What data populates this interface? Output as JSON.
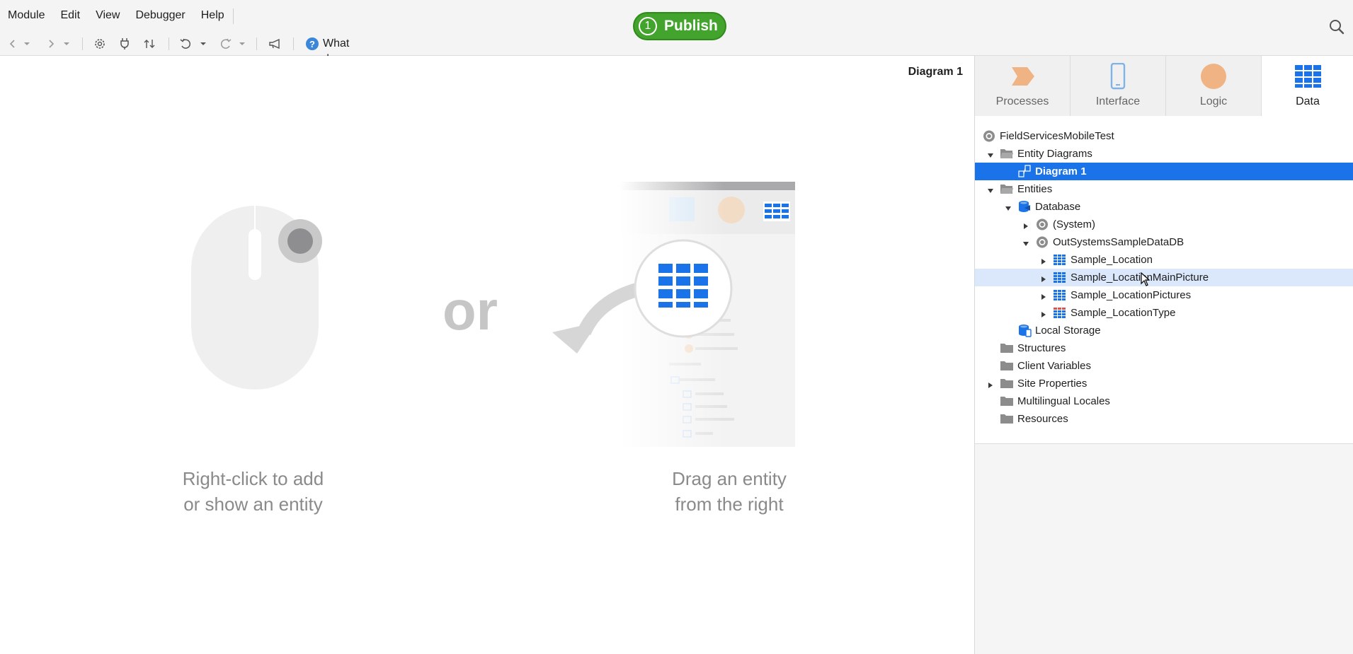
{
  "menu": [
    "Module",
    "Edit",
    "View",
    "Debugger",
    "Help"
  ],
  "publish": {
    "count": "1",
    "label": "Publish"
  },
  "toolbar": {
    "help_placeholder": "What do you want to do?"
  },
  "canvas": {
    "diagram_title": "Diagram 1",
    "hint_left": [
      "Right-click to add",
      "or show an entity"
    ],
    "or_text": "or",
    "hint_right": [
      "Drag an entity",
      "from the right"
    ]
  },
  "tabs": [
    {
      "label": "Processes",
      "icon": "process-icon"
    },
    {
      "label": "Interface",
      "icon": "phone-icon"
    },
    {
      "label": "Logic",
      "icon": "logic-icon"
    },
    {
      "label": "Data",
      "icon": "data-icon",
      "active": true
    }
  ],
  "tree": [
    {
      "label": "FieldServicesMobileTest",
      "icon": "module-icon",
      "level": 0,
      "caret": ""
    },
    {
      "label": "Entity Diagrams",
      "icon": "folder-open-icon",
      "level": 1,
      "caret": "down"
    },
    {
      "label": "Diagram 1",
      "icon": "diagram-icon",
      "level": 2,
      "caret": "",
      "selected": true
    },
    {
      "label": "Entities",
      "icon": "folder-open-icon",
      "level": 1,
      "caret": "down"
    },
    {
      "label": "Database",
      "icon": "database-icon",
      "level": 2,
      "caret": "down"
    },
    {
      "label": "(System)",
      "icon": "module-icon",
      "level": 3,
      "caret": "right"
    },
    {
      "label": "OutSystemsSampleDataDB",
      "icon": "module-icon",
      "level": 3,
      "caret": "down"
    },
    {
      "label": "Sample_Location",
      "icon": "entity-icon",
      "level": 4,
      "caret": "right"
    },
    {
      "label": "Sample_LocationMainPicture",
      "icon": "entity-icon",
      "level": 4,
      "caret": "right",
      "hover": true
    },
    {
      "label": "Sample_LocationPictures",
      "icon": "entity-icon",
      "level": 4,
      "caret": "right"
    },
    {
      "label": "Sample_LocationType",
      "icon": "static-entity-icon",
      "level": 4,
      "caret": "right"
    },
    {
      "label": "Local Storage",
      "icon": "local-storage-icon",
      "level": 2,
      "caret": ""
    },
    {
      "label": "Structures",
      "icon": "folder-icon",
      "level": 1,
      "caret": ""
    },
    {
      "label": "Client Variables",
      "icon": "folder-icon",
      "level": 1,
      "caret": ""
    },
    {
      "label": "Site Properties",
      "icon": "folder-icon",
      "level": 1,
      "caret": "right"
    },
    {
      "label": "Multilingual Locales",
      "icon": "folder-icon",
      "level": 1,
      "caret": ""
    },
    {
      "label": "Resources",
      "icon": "folder-icon",
      "level": 1,
      "caret": ""
    }
  ],
  "colors": {
    "accent": "#1a73e8",
    "publish": "#43a42d",
    "hover": "#dbe8fb"
  }
}
